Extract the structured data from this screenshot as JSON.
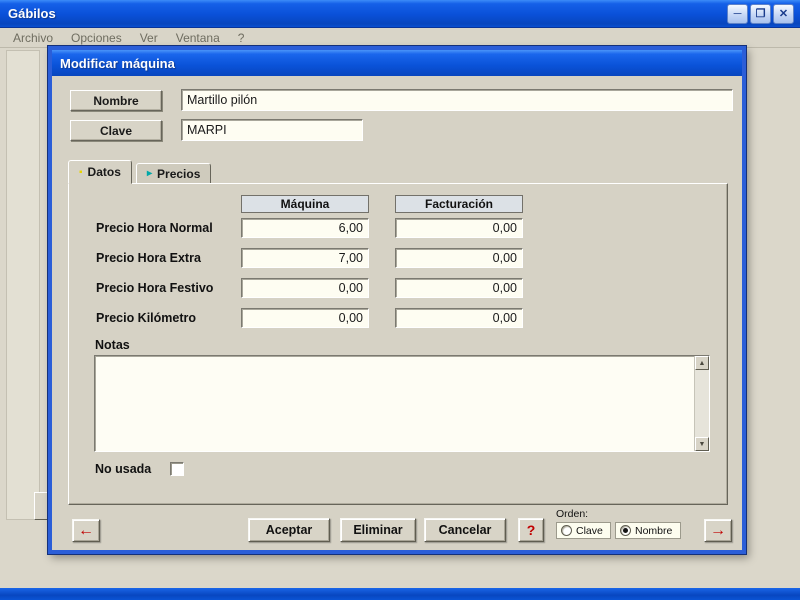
{
  "window": {
    "title": "Gábilos",
    "controls": {
      "minimize": "─",
      "maximize": "❐",
      "close": "✕"
    },
    "menu": [
      {
        "label": "Archivo"
      },
      {
        "label": "Opciones"
      },
      {
        "label": "Ver"
      },
      {
        "label": "Ventana"
      },
      {
        "label": "?"
      }
    ]
  },
  "dialog": {
    "title": "Modificar máquina",
    "name_label": "Nombre",
    "name_value": "Martillo pilón",
    "key_label": "Clave",
    "key_value": "MARPI",
    "tabs": [
      {
        "label": "Datos",
        "marker": "▪",
        "active": true
      },
      {
        "label": "Precios",
        "marker": "▸",
        "active": false
      }
    ],
    "price_grid": {
      "columns": [
        "Máquina",
        "Facturación"
      ],
      "rows": [
        {
          "label": "Precio Hora Normal",
          "maquina": "6,00",
          "facturacion": "0,00"
        },
        {
          "label": "Precio Hora Extra",
          "maquina": "7,00",
          "facturacion": "0,00"
        },
        {
          "label": "Precio Hora Festivo",
          "maquina": "0,00",
          "facturacion": "0,00"
        },
        {
          "label": "Precio Kilómetro",
          "maquina": "0,00",
          "facturacion": "0,00"
        }
      ]
    },
    "notes_label": "Notas",
    "notes_value": "",
    "scrollbar": {
      "up": "▲",
      "down": "▼"
    },
    "not_used_label": "No usada",
    "not_used_checked": false,
    "footer": {
      "prev_icon": "←",
      "accept": "Aceptar",
      "delete": "Eliminar",
      "cancel": "Cancelar",
      "help": "?",
      "order_label": "Orden:",
      "order_options": [
        {
          "label": "Clave",
          "selected": false
        },
        {
          "label": "Nombre",
          "selected": true
        }
      ],
      "next_icon": "→"
    }
  },
  "colors": {
    "titlebar_blue": "#0A52D8",
    "dialog_border": "#2B5ED8",
    "accent_red": "#C00000",
    "field_bg": "#FEFDF2",
    "body_gray": "#D6D2C5",
    "tab_marker_yellow": "#E8D400",
    "tab_marker_teal": "#00A8A8"
  }
}
